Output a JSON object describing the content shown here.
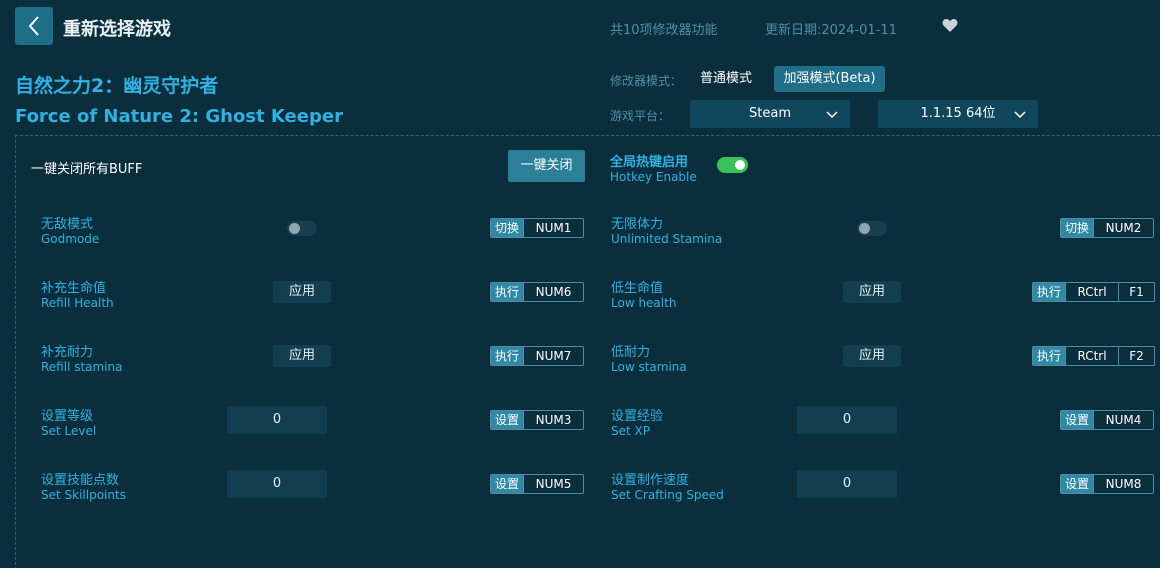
{
  "header": {
    "title": "重新选择游戏",
    "feature_count": "共10项修改器功能",
    "update_date": "更新日期:2024-01-11"
  },
  "game": {
    "name_cn": "自然之力2：幽灵守护者",
    "name_en": "Force of Nature 2: Ghost Keeper"
  },
  "mode": {
    "label": "修改器模式：",
    "normal": "普通模式",
    "beta": "加强模式(Beta)"
  },
  "platform": {
    "label": "游戏平台：",
    "platform_value": "Steam",
    "version_value": "1.1.15 64位"
  },
  "buff": {
    "label": "一键关闭所有BUFF",
    "close_button": "一键关闭"
  },
  "hotkey_enable": {
    "cn": "全局热键启用",
    "en": "Hotkey Enable",
    "enabled": true
  },
  "cheats": {
    "godmode": {
      "cn": "无敌模式",
      "en": "Godmode",
      "action": "切换",
      "key1": "NUM1",
      "on": false
    },
    "stamina": {
      "cn": "无限体力",
      "en": "Unlimited Stamina",
      "action": "切换",
      "key1": "NUM2",
      "on": false
    },
    "refill_health": {
      "cn": "补充生命值",
      "en": "Refill Health",
      "button": "应用",
      "action": "执行",
      "key1": "NUM6"
    },
    "low_health": {
      "cn": "低生命值",
      "en": "Low health",
      "button": "应用",
      "action": "执行",
      "key1": "RCtrl",
      "key2": "F1"
    },
    "refill_stamina": {
      "cn": "补充耐力",
      "en": "Refill stamina",
      "button": "应用",
      "action": "执行",
      "key1": "NUM7"
    },
    "low_stamina": {
      "cn": "低耐力",
      "en": "Low stamina",
      "button": "应用",
      "action": "执行",
      "key1": "RCtrl",
      "key2": "F2"
    },
    "set_level": {
      "cn": "设置等级",
      "en": "Set Level",
      "value": "0",
      "action": "设置",
      "key1": "NUM3"
    },
    "set_xp": {
      "cn": "设置经验",
      "en": "Set XP",
      "value": "0",
      "action": "设置",
      "key1": "NUM4"
    },
    "set_skillpoints": {
      "cn": "设置技能点数",
      "en": "Set Skillpoints",
      "value": "0",
      "action": "设置",
      "key1": "NUM5"
    },
    "set_crafting": {
      "cn": "设置制作速度",
      "en": "Set Crafting Speed",
      "value": "0",
      "action": "设置",
      "key1": "NUM8"
    }
  },
  "colors": {
    "background": "#0b2e3d",
    "accent": "#2fb1e2",
    "toggle_on": "#3ac15a"
  }
}
